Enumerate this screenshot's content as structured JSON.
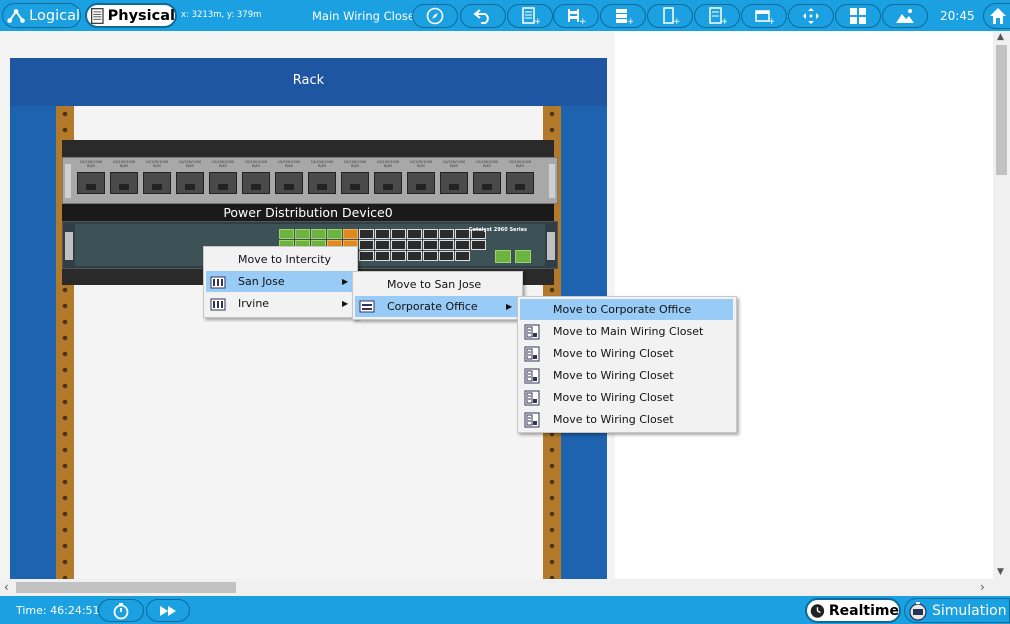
{
  "header": {
    "logical_label": "Logical",
    "physical_label": "Physical",
    "coords": "x: 3213m, y: 379m",
    "location": "Main Wiring Closet",
    "clock": "20:45",
    "toolbar_icons": [
      "navigation-icon",
      "back-icon",
      "new-rack-icon",
      "new-table-icon",
      "new-shelf-icon",
      "new-device-icon",
      "new-cluster-icon",
      "new-pdu-icon",
      "move-icon",
      "grid-icon",
      "background-icon"
    ]
  },
  "workspace": {
    "rack_title": "Rack",
    "pdu_label": "Power Distribution Device0",
    "switch_brand": "Catalyst 2960 Series",
    "patch_port_label": "10/100/1000 RJ45"
  },
  "menu1": {
    "items": [
      {
        "label": "Move to Intercity",
        "icon": "none"
      },
      {
        "label": "San Jose",
        "icon": "city-icon",
        "submenu": true
      },
      {
        "label": "Irvine",
        "icon": "city-icon",
        "submenu": true
      }
    ]
  },
  "menu2": {
    "items": [
      {
        "label": "Move to San Jose"
      },
      {
        "label": "Corporate Office",
        "icon": "building-icon",
        "submenu": true
      }
    ]
  },
  "menu3": {
    "items": [
      {
        "label": "Move to Corporate Office"
      },
      {
        "label": "Move to Main Wiring Closet"
      },
      {
        "label": "Move to Wiring Closet"
      },
      {
        "label": "Move to Wiring Closet"
      },
      {
        "label": "Move to Wiring Closet"
      },
      {
        "label": "Move to Wiring Closet"
      }
    ]
  },
  "footer": {
    "time": "Time: 46:24:51",
    "realtime_label": "Realtime",
    "simulation_label": "Simulation"
  },
  "colors": {
    "toolbar": "#1ba0e1",
    "rack": "#1d63b0",
    "menu_highlight": "#99cbf7"
  }
}
